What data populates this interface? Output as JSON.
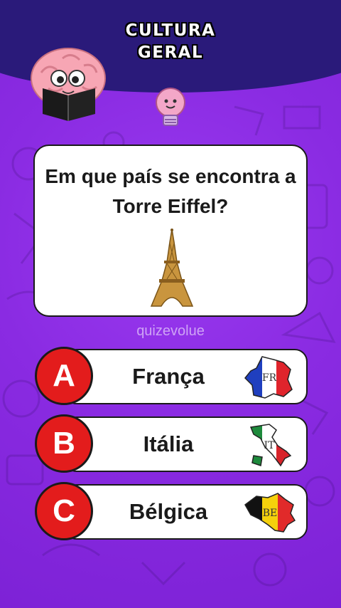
{
  "header": {
    "title_line1": "CULTURA",
    "title_line2": "GERAL"
  },
  "question": {
    "text": "Em que país se encontra a Torre Eiffel?"
  },
  "watermark": "quizevolue",
  "options": [
    {
      "letter": "A",
      "label": "França",
      "flag_code": "FR",
      "flag_icon": "france-map-flag-icon"
    },
    {
      "letter": "B",
      "label": "Itália",
      "flag_code": "IT",
      "flag_icon": "italy-map-flag-icon"
    },
    {
      "letter": "C",
      "label": "Bélgica",
      "flag_code": "BE",
      "flag_icon": "belgium-map-flag-icon"
    }
  ],
  "colors": {
    "background": "#8a2be2",
    "header_band": "#2a1a7a",
    "letter_badge": "#e31c1c",
    "card": "#ffffff"
  }
}
